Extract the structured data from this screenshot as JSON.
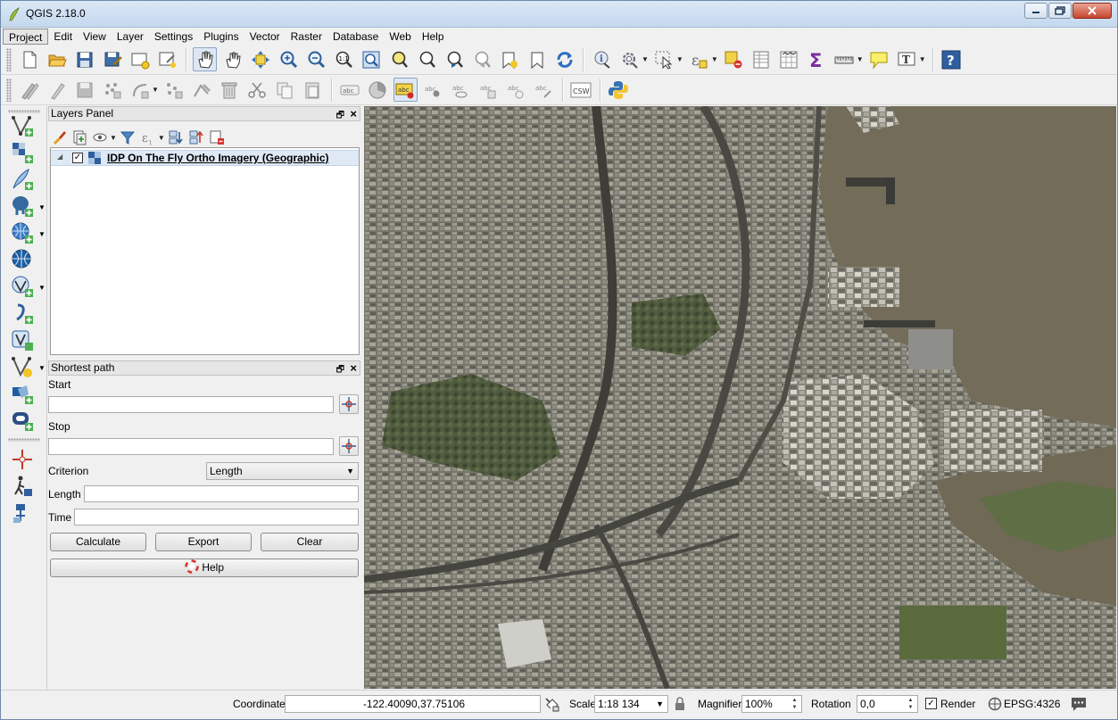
{
  "window": {
    "title": "QGIS 2.18.0"
  },
  "menu": [
    "Project",
    "Edit",
    "View",
    "Layer",
    "Settings",
    "Plugins",
    "Vector",
    "Raster",
    "Database",
    "Web",
    "Help"
  ],
  "layers_panel": {
    "title": "Layers Panel",
    "layers": [
      {
        "name": "IDP On The Fly Ortho Imagery (Geographic)",
        "checked": true
      }
    ]
  },
  "shortest_path": {
    "title": "Shortest path",
    "start_label": "Start",
    "start_value": "",
    "stop_label": "Stop",
    "stop_value": "",
    "criterion_label": "Criterion",
    "criterion_value": "Length",
    "length_label": "Length",
    "length_value": "",
    "time_label": "Time",
    "time_value": "",
    "calculate_label": "Calculate",
    "export_label": "Export",
    "clear_label": "Clear",
    "help_label": "Help"
  },
  "toolbar2": {
    "csw_label": "CSW"
  },
  "status": {
    "coordinate_label": "Coordinate",
    "coordinate_value": "-122.40090,37.75106",
    "scale_label": "Scale",
    "scale_value": "1:18 134",
    "magnifier_label": "Magnifier",
    "magnifier_value": "100%",
    "rotation_label": "Rotation",
    "rotation_value": "0,0",
    "render_label": "Render",
    "render_checked": true,
    "crs_label": "EPSG:4326"
  }
}
